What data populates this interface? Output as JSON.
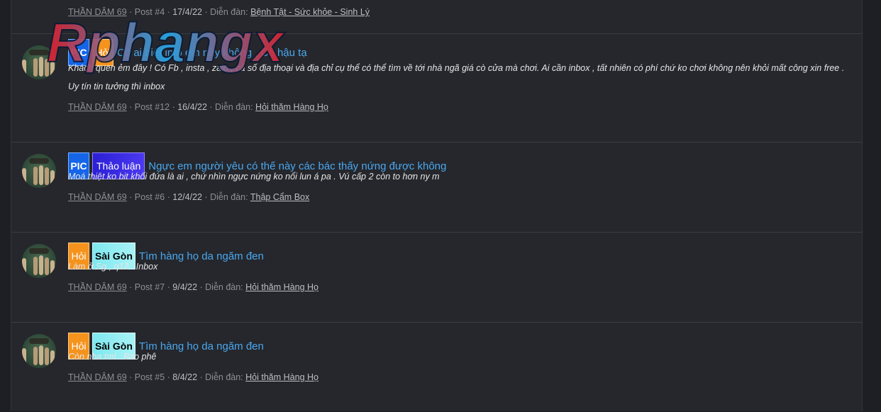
{
  "logo": {
    "text": "Rphangx"
  },
  "posts": [
    {
      "meta": {
        "author": "THẦN DÂM 69",
        "post": "Post #4",
        "date": "17/4/22",
        "forum_label": "Diễn đàn:",
        "forum": "Bệnh Tật - Sức khỏe - Sinh Lý"
      }
    },
    {
      "prefixes": [
        "PIC",
        "Hỏi"
      ],
      "title": "Có ai biết info em này không , Có hậu tạ",
      "snippet": "Khách quen ẻm đây ! Có Fb , insta , zalo , cả số địa thoại và địa chỉ cụ thể có thể tìm về tới nhà ngã giá cò cửa mà chơi. Ai cần inbox , tất nhiên có phí chứ ko chơi không nên khỏi mất công xin free . Uy tín tin tưởng thì inbox",
      "meta": {
        "author": "THẦN DÂM 69",
        "post": "Post #12",
        "date": "16/4/22",
        "forum_label": "Diễn đàn:",
        "forum": "Hỏi thăm Hàng Họ"
      }
    },
    {
      "prefixes": [
        "PIC",
        "Thảo luận"
      ],
      "title": "Ngực em người yêu có thế này các bác thấy nứng được không",
      "snippet": "Moá thiệt ko bit khối đứa là ai , chứ nhìn ngực nứng ko nổi lun á pa . Vú cấp 2 còn to hơn ny m",
      "meta": {
        "author": "THẦN DÂM 69",
        "post": "Post #6",
        "date": "12/4/22",
        "forum_label": "Diễn đàn:",
        "forum": "Thập Cẩm Box"
      }
    },
    {
      "prefixes": [
        "Hỏi",
        "Sài Gòn"
      ],
      "title": "Tìm hàng họ da ngăm đen",
      "snippet": "Làm ở Sg , q12 . Inbox",
      "meta": {
        "author": "THẦN DÂM 69",
        "post": "Post #7",
        "date": "9/4/22",
        "forum_label": "Diễn đàn:",
        "forum": "Hỏi thăm Hàng Họ"
      }
    },
    {
      "prefixes": [
        "Hỏi",
        "Sài Gòn"
      ],
      "title": "Tìm hàng họ da ngăm đen",
      "snippet": "Còn nha tml . Bao phê",
      "meta": {
        "author": "THẦN DÂM 69",
        "post": "Post #5",
        "date": "8/4/22",
        "forum_label": "Diễn đàn:",
        "forum": "Hỏi thăm Hàng Họ"
      }
    }
  ]
}
